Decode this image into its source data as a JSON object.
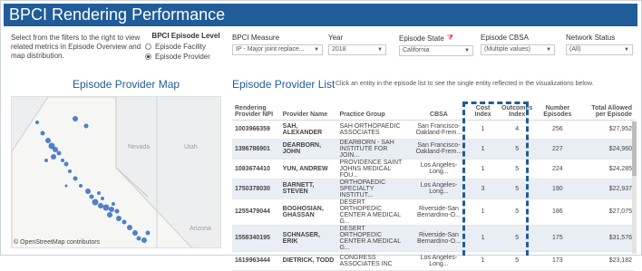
{
  "title": "BPCI Rendering Performance",
  "intro": "Select from the filters to the right to view related metrics in Episode Overview and map distribution.",
  "episode_level": {
    "label": "BPCI Episode Level",
    "options": [
      "Episode Facility",
      "Episode Provider"
    ],
    "selected": "Episode Provider"
  },
  "filters": {
    "measure": {
      "label": "BPCI Measure",
      "value": "IP - Major joint replace..."
    },
    "year": {
      "label": "Year",
      "value": "2018"
    },
    "state": {
      "label": "Episode State",
      "value": "California"
    },
    "cbsa": {
      "label": "Episode CBSA",
      "value": "(Multiple values)"
    },
    "network": {
      "label": "Network Status",
      "value": "(All)"
    }
  },
  "map_section": {
    "title": "Episode Provider Map",
    "attribution": "© OpenStreetMap contributors",
    "labels": {
      "nevada": "Nevada",
      "utah": "Utah",
      "arizona": "Arizona"
    }
  },
  "list_section": {
    "title": "Episode Provider List",
    "note": "Click an entity in the episode list to see the single entity reflected in the visualizations below."
  },
  "table": {
    "headers": [
      "Rendering Provider NPI",
      "Provider Name",
      "Practice Group",
      "CBSA",
      "Cost Index",
      "Outcomes Index",
      "Number Episodes",
      "Total Allowed per Episode"
    ],
    "rows": [
      [
        "1003966359",
        "SAH, ALEXANDER",
        "SAH ORTHOPAEDIC ASSOCIATES",
        "San Francisco-Oakland-Frem...",
        "1",
        "4",
        "256",
        "$27,952"
      ],
      [
        "1396786901",
        "DEARBORN, JOHN",
        "DEARBORN - SAH INSTITUTE FOR JOIN...",
        "San Francisco-Oakland-Frem...",
        "1",
        "5",
        "227",
        "$24,960"
      ],
      [
        "1083674410",
        "YUN, ANDREW",
        "PROVIDENCE SAINT JOHNS MEDICAL FOU...",
        "Los Angeles-Long...",
        "1",
        "5",
        "224",
        "$24,285"
      ],
      [
        "1750378030",
        "BARNETT, STEVEN",
        "ORTHOPAEDIC SPECIALTY INSTITUT...",
        "Los Angeles-Long...",
        "3",
        "5",
        "190",
        "$22,937"
      ],
      [
        "1255479044",
        "BOGHOSIAN, GHASSAN",
        "DESERT ORTHOPEDIC CENTER A MEDICAL G...",
        "Riverside-San Bernardino-O...",
        "1",
        "5",
        "186",
        "$27,075"
      ],
      [
        "1558340195",
        "SCHNASER, ERIK",
        "DESERT ORTHOPEDIC CENTER A MEDICAL G...",
        "Riverside-San Bernardino-O...",
        "1",
        "5",
        "175",
        "$31,576"
      ],
      [
        "1619963444",
        "DIETRICK, TODD",
        "CONGRESS ASSOCIATES INC",
        "Los Angeles-Long...",
        "1",
        "5",
        "173",
        "$23,182"
      ]
    ]
  },
  "colors": {
    "accent": "#1f5c99",
    "map_dot": "#2f6cc0",
    "row_alt": "#e9eef5",
    "filter_icon": "#dd3333"
  }
}
